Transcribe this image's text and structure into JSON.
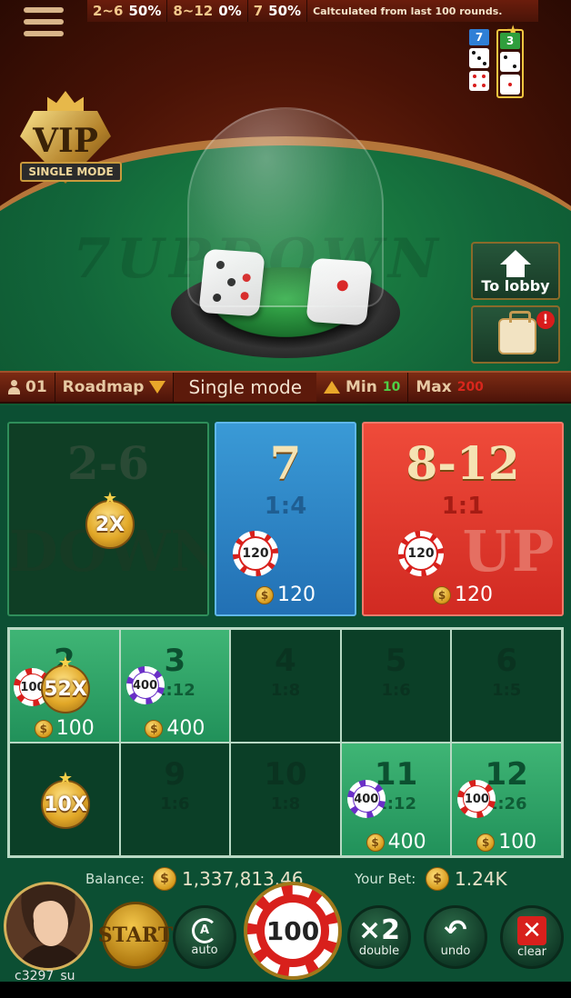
{
  "stats": {
    "items": [
      {
        "range": "2~6",
        "pct": "50%"
      },
      {
        "range": "8~12",
        "pct": "0%"
      },
      {
        "range": "7",
        "pct": "50%"
      }
    ],
    "note": "Caltculated from last 100 rounds."
  },
  "history": [
    {
      "sum": "7",
      "color": "#2f7fd6",
      "dice": [
        3,
        4
      ]
    },
    {
      "sum": "3",
      "color": "#2f9e3c",
      "dice": [
        2,
        1
      ]
    }
  ],
  "vip": {
    "title": "VIP",
    "ribbon": "SINGLE MODE"
  },
  "felt_watermark": "7UPDOWN",
  "side": {
    "lobby_label": "To lobby",
    "bag_badge": "!"
  },
  "info_bar": {
    "players": "01",
    "roadmap": "Roadmap",
    "mode": "Single mode",
    "min_label": "Min",
    "min_value": "10",
    "max_label": "Max",
    "max_value": "200"
  },
  "big_bets": {
    "down": {
      "title": "2-6",
      "ghost": "DOWN",
      "multiplier": "2X"
    },
    "seven": {
      "title": "7",
      "odds": "1:4",
      "chip": "120",
      "amount": "120"
    },
    "up": {
      "title": "8-12",
      "odds": "1:1",
      "ghost": "UP",
      "chip": "120",
      "amount": "120"
    }
  },
  "grid": [
    {
      "num": "2",
      "odds": "",
      "active": true,
      "multiplier": "52X",
      "chip": "100",
      "chip_color": "red",
      "amount": "100"
    },
    {
      "num": "3",
      "odds": "1:12",
      "active": true,
      "chip": "400",
      "chip_color": "purple",
      "amount": "400"
    },
    {
      "num": "4",
      "odds": "1:8",
      "active": false
    },
    {
      "num": "5",
      "odds": "1:6",
      "active": false
    },
    {
      "num": "6",
      "odds": "1:5",
      "active": false
    },
    {
      "num": "",
      "odds": "",
      "active": false,
      "multiplier": "10X"
    },
    {
      "num": "9",
      "odds": "1:6",
      "active": false
    },
    {
      "num": "10",
      "odds": "1:8",
      "active": false
    },
    {
      "num": "11",
      "odds": "1:12",
      "active": true,
      "chip": "400",
      "chip_color": "purple",
      "amount": "400"
    },
    {
      "num": "12",
      "odds": "1:26",
      "active": true,
      "chip": "100",
      "chip_color": "red",
      "amount": "100"
    }
  ],
  "balance": {
    "label": "Balance:",
    "value": "1,337,813.46"
  },
  "your_bet": {
    "label": "Your Bet:",
    "value": "1.24K"
  },
  "user": {
    "name": "c3297_su"
  },
  "controls": {
    "start": "START",
    "auto": "auto",
    "auto_icon": "A",
    "chip_value": "100",
    "double_icon": "×2",
    "double": "double",
    "undo_icon": "↶",
    "undo": "undo",
    "clear_icon": "✕",
    "clear": "clear"
  },
  "coin_symbol": "$",
  "colors": {
    "felt": "#12663a",
    "wood": "#4a1306",
    "seven": "#2f86c8",
    "up": "#e03a2e",
    "gold": "#e2a828"
  }
}
